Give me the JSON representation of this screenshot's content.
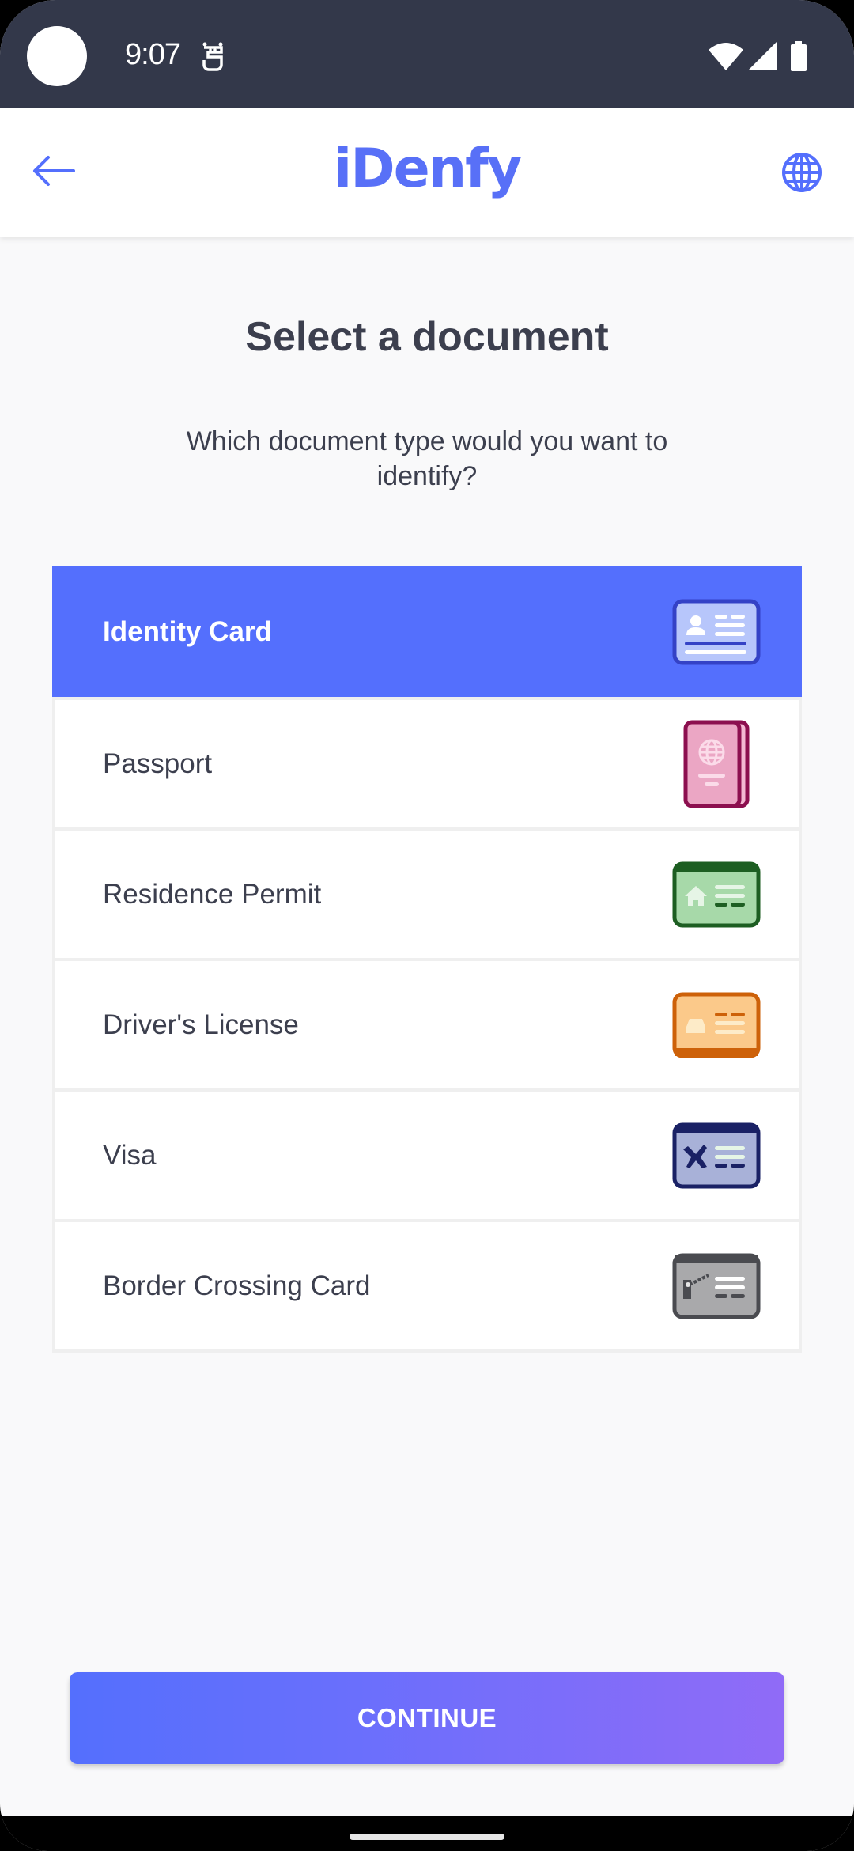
{
  "status_bar": {
    "time": "9:07",
    "icons": [
      "notification-app-icon",
      "wifi-icon",
      "signal-icon",
      "battery-icon"
    ]
  },
  "app_bar": {
    "back_icon": "arrow-left-icon",
    "logo": "iDenfy",
    "language_icon": "globe-icon"
  },
  "main": {
    "title": "Select a document",
    "subtitle": "Which document type would you want to identify?",
    "documents": [
      {
        "label": "Identity Card",
        "icon": "identity-card-icon",
        "selected": true
      },
      {
        "label": "Passport",
        "icon": "passport-icon",
        "selected": false
      },
      {
        "label": "Residence Permit",
        "icon": "residence-permit-icon",
        "selected": false
      },
      {
        "label": "Driver's License",
        "icon": "drivers-license-icon",
        "selected": false
      },
      {
        "label": "Visa",
        "icon": "visa-icon",
        "selected": false
      },
      {
        "label": "Border Crossing Card",
        "icon": "border-crossing-card-icon",
        "selected": false
      }
    ]
  },
  "footer": {
    "continue_label": "CONTINUE"
  },
  "colors": {
    "brand": "#546ffd",
    "gradient_end": "#906bf7",
    "status_bar": "#33384a",
    "text": "#3c3f4e"
  }
}
